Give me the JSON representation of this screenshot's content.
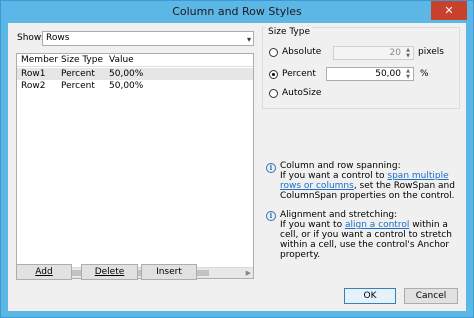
{
  "window": {
    "title": "Column and Row Styles",
    "close_glyph": "✕"
  },
  "show": {
    "label": "Show:",
    "value": "Rows"
  },
  "grid": {
    "columns": [
      "Member",
      "Size Type",
      "Value"
    ],
    "rows": [
      {
        "member": "Row1",
        "size_type": "Percent",
        "value": "50,00%"
      },
      {
        "member": "Row2",
        "size_type": "Percent",
        "value": "50,00%"
      }
    ]
  },
  "buttons": {
    "add": "Add",
    "delete": "Delete",
    "insert": "Insert",
    "ok": "OK",
    "cancel": "Cancel"
  },
  "size_type": {
    "group_label": "Size Type",
    "absolute_label": "Absolute",
    "absolute_value": "20",
    "absolute_unit": "pixels",
    "percent_label": "Percent",
    "percent_value": "50,00",
    "percent_unit": "%",
    "autosize_label": "AutoSize",
    "selected": "percent"
  },
  "info": {
    "spanning": {
      "heading": "Column and row spanning:",
      "pre": "If you want a control to",
      "link": "span multiple rows or columns",
      "post": ", set the RowSpan and ColumnSpan properties on the control."
    },
    "alignment": {
      "heading": "Alignment and stretching:",
      "pre": "If you want to",
      "link": "align a control",
      "post": "within a cell, or if you want a control to stretch within a cell, use the control's Anchor property."
    }
  },
  "icons": {
    "info": "i",
    "dropdown": "▾",
    "spin_up": "▲",
    "spin_down": "▼"
  }
}
